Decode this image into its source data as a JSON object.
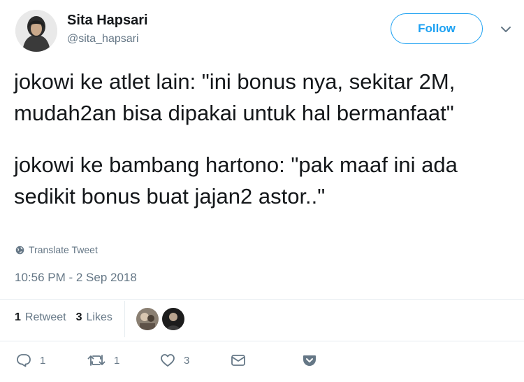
{
  "author": {
    "display_name": "Sita Hapsari",
    "handle": "@sita_hapsari"
  },
  "header": {
    "follow_label": "Follow"
  },
  "tweet": {
    "paragraphs": [
      "jokowi ke atlet lain: \"ini bonus nya, sekitar 2M, mudah2an bisa dipakai untuk hal bermanfaat\"",
      "jokowi ke bambang hartono: \"pak maaf ini ada sedikit bonus buat jajan2 astor..\""
    ],
    "translate_label": "Translate Tweet",
    "timestamp": "10:56 PM - 2 Sep 2018"
  },
  "stats": {
    "retweets_count": "1",
    "retweets_label": "Retweet",
    "likes_count": "3",
    "likes_label": "Likes"
  },
  "actions": {
    "reply_count": "1",
    "retweet_count": "1",
    "like_count": "3"
  },
  "colors": {
    "accent": "#1da1f2",
    "secondary_text": "#657786",
    "divider": "#e6ecf0"
  }
}
